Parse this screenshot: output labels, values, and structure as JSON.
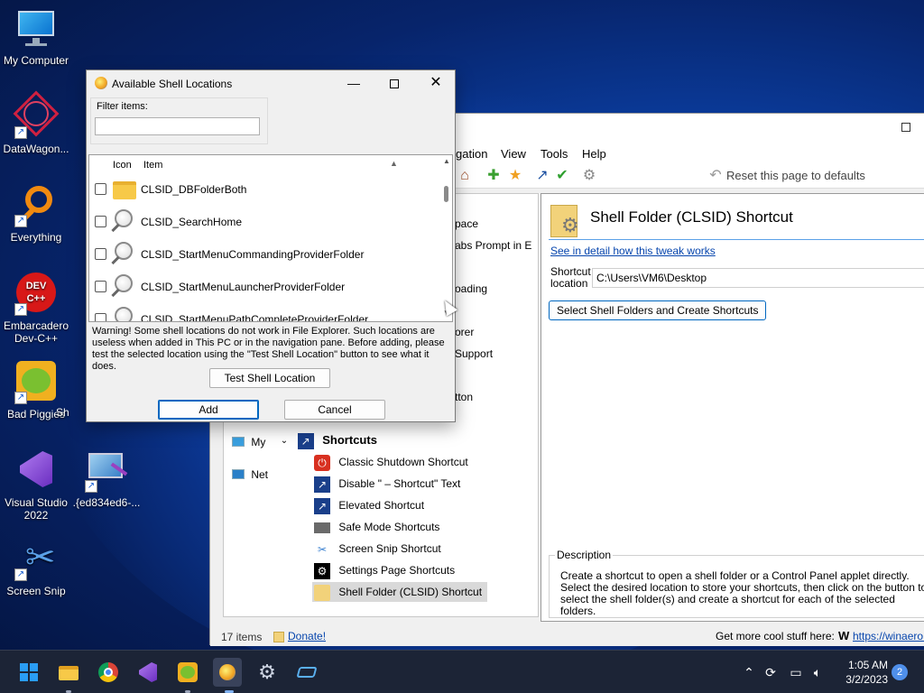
{
  "desktop": {
    "icons": [
      {
        "label": "My Computer"
      },
      {
        "label": "DataWagon..."
      },
      {
        "label": "Everything"
      },
      {
        "label": "Embarcadero Dev-C++"
      },
      {
        "label": "Bad Piggies"
      },
      {
        "label": "Visual Studio 2022"
      },
      {
        "label": ".{ed834ed6-..."
      },
      {
        "label": "Screen Snip"
      }
    ],
    "partial_label": "Sh"
  },
  "main_window": {
    "menu": [
      "gation",
      "View",
      "Tools",
      "Help"
    ],
    "reset_label": "Reset this page to defaults",
    "tree_partial": [
      "pace",
      "abs Prompt in E",
      "oading",
      "orer",
      "Support",
      "tton"
    ],
    "nav_partial": [
      "My",
      "Net"
    ],
    "tree": {
      "group_label": "Shortcuts",
      "items": [
        {
          "label": "Classic Shutdown Shortcut",
          "icon": "power-icon"
        },
        {
          "label": "Disable \" – Shortcut\" Text",
          "icon": "shortcut-arrow-icon"
        },
        {
          "label": "Elevated Shortcut",
          "icon": "shield-shortcut-icon"
        },
        {
          "label": "Safe Mode Shortcuts",
          "icon": "safe-mode-icon"
        },
        {
          "label": "Screen Snip Shortcut",
          "icon": "scissors-icon"
        },
        {
          "label": "Settings Page Shortcuts",
          "icon": "gear-icon"
        },
        {
          "label": "Shell Folder (CLSID) Shortcut",
          "icon": "shell-folder-icon"
        }
      ]
    },
    "page": {
      "title": "Shell Folder (CLSID) Shortcut",
      "detail_link": "See in detail how this tweak works",
      "location_label": "Shortcut location",
      "location_value": "C:\\Users\\VM6\\Desktop",
      "action_button": "Select Shell Folders and Create Shortcuts",
      "description_title": "Description",
      "description_text": "Create a shortcut to open a shell folder or a Control Panel applet directly.\nSelect the desired location to store your shortcuts, then click on the button to select the shell folder(s) and create a shortcut for each of the selected folders."
    },
    "status": {
      "items_count": "17 items",
      "donate": "Donate!",
      "more_stuff": "Get more cool stuff here:",
      "winaero_link": "https://winaero.com"
    }
  },
  "dialog": {
    "title": "Available Shell Locations",
    "filter_label": "Filter items:",
    "filter_value": "",
    "columns": {
      "icon": "Icon",
      "item": "Item"
    },
    "rows": [
      {
        "label": "CLSID_DBFolderBoth",
        "icon": "folder-icon"
      },
      {
        "label": "CLSID_SearchHome",
        "icon": "magnifier-icon"
      },
      {
        "label": "CLSID_StartMenuCommandingProviderFolder",
        "icon": "magnifier-icon"
      },
      {
        "label": "CLSID_StartMenuLauncherProviderFolder",
        "icon": "magnifier-icon"
      },
      {
        "label": "CLSID_StartMenuPathCompleteProviderFolder",
        "icon": "magnifier-icon"
      }
    ],
    "warning": "Warning! Some shell locations do not work in File Explorer. Such locations are useless when added in This PC or in the navigation pane. Before adding, please test the selected location using the \"Test Shell Location\" button to see what it does.",
    "test_button": "Test Shell Location",
    "add_button": "Add",
    "cancel_button": "Cancel"
  },
  "taskbar": {
    "clock_time": "1:05 AM",
    "clock_date": "3/2/2023",
    "notification_count": "2"
  }
}
